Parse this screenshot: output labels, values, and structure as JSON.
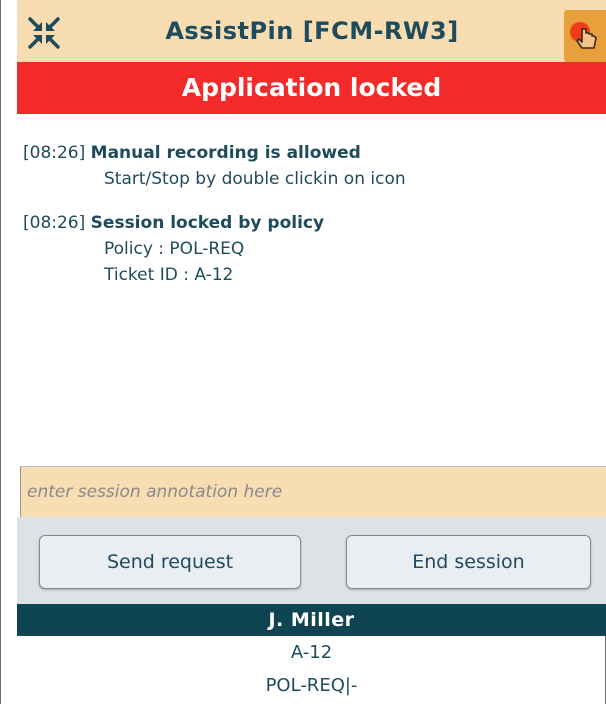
{
  "window": {
    "title": "AssistPin [FCM-RW3]",
    "collapse_icon": "collapse-arrows-icon",
    "pin_icon": "hand-pointer-icon",
    "colors": {
      "titlebar": "#f8dcb2",
      "title_text": "#1f4c5c",
      "pin_button": "#e8a13a"
    }
  },
  "banner": {
    "text": "Application locked",
    "color": "#f22a2a"
  },
  "log": {
    "entries": [
      {
        "time": "[08:26]",
        "title": "Manual recording is allowed",
        "details": [
          "Start/Stop by double clickin on icon"
        ]
      },
      {
        "time": "[08:26]",
        "title": "Session locked by policy",
        "details": [
          "Policy : POL-REQ",
          "Ticket ID : A-12"
        ]
      }
    ]
  },
  "annotation": {
    "placeholder": "enter session annotation here",
    "value": ""
  },
  "buttons": {
    "send_request": "Send request",
    "end_session": "End session"
  },
  "footer": {
    "user": "J. Miller",
    "ticket": "A-12",
    "policy": "POL-REQ|-",
    "user_bar_color": "#0f4552"
  }
}
